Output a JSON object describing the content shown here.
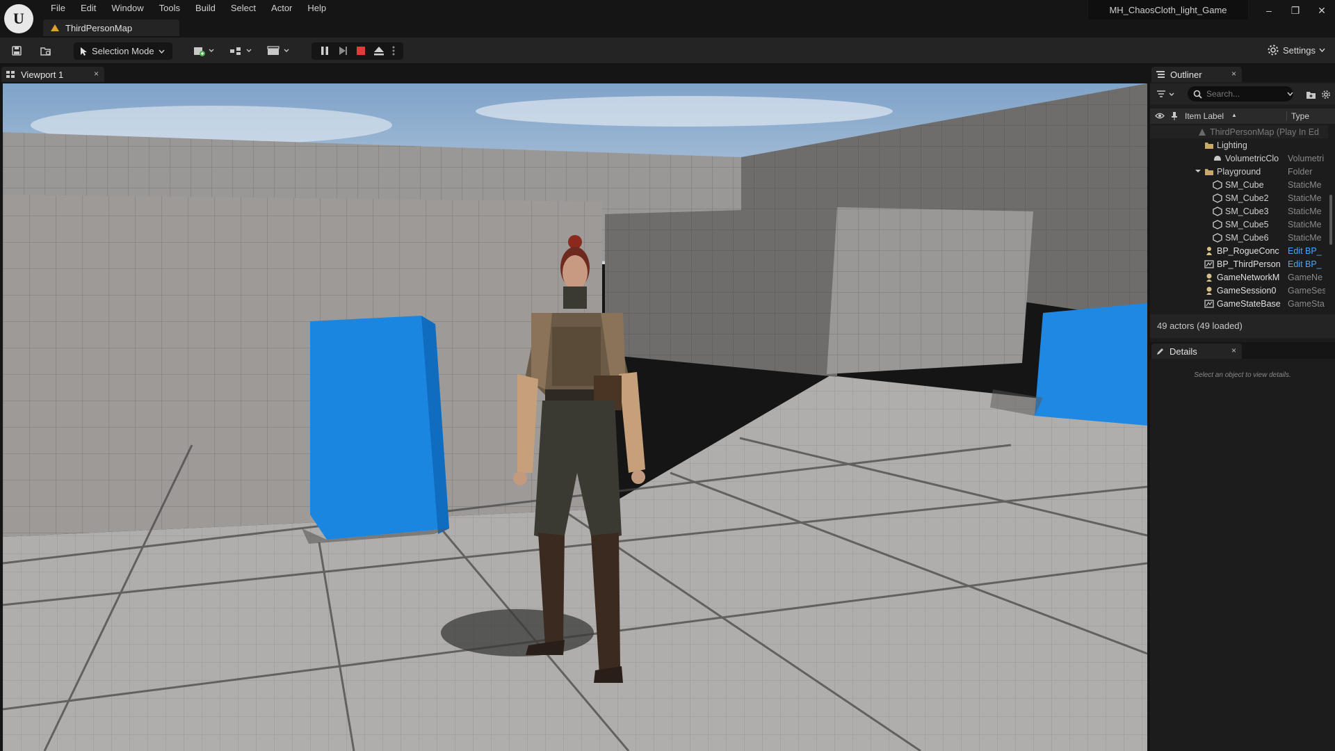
{
  "app": {
    "logo_letter": "U",
    "menu": [
      "File",
      "Edit",
      "Window",
      "Tools",
      "Build",
      "Select",
      "Actor",
      "Help"
    ],
    "document_tab": "ThirdPersonMap",
    "project_name": "MH_ChaosCloth_light_Game",
    "window_controls": {
      "minimize": "–",
      "restore": "❐",
      "close": "✕"
    }
  },
  "toolbar": {
    "selection_mode": "Selection Mode",
    "settings": "Settings",
    "icons": [
      "save-icon",
      "content-browser-icon",
      "add-actor-icon",
      "blueprint-icon",
      "cinematics-icon",
      "pause-icon",
      "frame-skip-icon",
      "stop-icon",
      "eject-icon",
      "more-options-icon"
    ]
  },
  "viewport": {
    "tab_label": "Viewport 1",
    "close": "×"
  },
  "outliner": {
    "tab_label": "Outliner",
    "close": "×",
    "search_placeholder": "Search...",
    "col_label": "Item Label",
    "sort_indicator": "▲",
    "col_type": "Type",
    "rows": [
      {
        "label": "ThirdPersonMap (Play In Ed",
        "type": "",
        "indent": 0,
        "icon": "map-icon",
        "dim": true
      },
      {
        "label": "Lighting",
        "type": "",
        "indent": 1,
        "icon": "folder-icon"
      },
      {
        "label": "VolumetricClo",
        "type": "Volumetri",
        "indent": 2,
        "icon": "actor-icon"
      },
      {
        "label": "Playground",
        "type": "Folder",
        "indent": 1,
        "icon": "folder-icon",
        "expanded": true
      },
      {
        "label": "SM_Cube",
        "type": "StaticMe",
        "indent": 2,
        "icon": "mesh-icon"
      },
      {
        "label": "SM_Cube2",
        "type": "StaticMe",
        "indent": 2,
        "icon": "mesh-icon"
      },
      {
        "label": "SM_Cube3",
        "type": "StaticMe",
        "indent": 2,
        "icon": "mesh-icon"
      },
      {
        "label": "SM_Cube5",
        "type": "StaticMe",
        "indent": 2,
        "icon": "mesh-icon"
      },
      {
        "label": "SM_Cube6",
        "type": "StaticMe",
        "indent": 2,
        "icon": "mesh-icon"
      },
      {
        "label": "BP_RogueConc",
        "type": "Edit BP_",
        "indent": 1,
        "icon": "pawn-icon",
        "link": true
      },
      {
        "label": "BP_ThirdPerson",
        "type": "Edit BP_",
        "indent": 1,
        "icon": "gamemode-icon",
        "link": true
      },
      {
        "label": "GameNetworkM",
        "type": "GameNe",
        "indent": 1,
        "icon": "info-icon"
      },
      {
        "label": "GameSession0",
        "type": "GameSes",
        "indent": 1,
        "icon": "info-icon"
      },
      {
        "label": "GameStateBase",
        "type": "GameSta",
        "indent": 1,
        "icon": "gamestate-icon"
      }
    ],
    "actor_count": "49 actors (49 loaded)"
  },
  "details": {
    "tab_label": "Details",
    "close": "×",
    "empty_text": "Select an object to view details."
  }
}
